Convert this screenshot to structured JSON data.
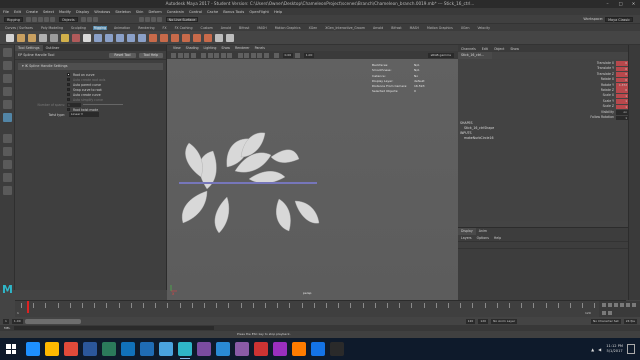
{
  "window": {
    "title": "Autodesk Maya 2017 - Student Version: C:\\Users\\Owner\\Desktop\\ChameleonProject\\scenes\\Branch\\Chameleon_branch.0019.mb* --- Stick_16_ctrl...",
    "workspace": "Workspace:",
    "workspace_value": "Maya Classic"
  },
  "menubar": [
    "File",
    "Edit",
    "Create",
    "Select",
    "Modify",
    "Display",
    "Windows",
    "Skeleton",
    "Skin",
    "Deform",
    "Constrain",
    "Control",
    "Cache",
    "Bonus Tools",
    "OpenFlight",
    "Help"
  ],
  "statusline": {
    "mode": "Rigging",
    "objects": "Objects",
    "live": "No Live Surface"
  },
  "shelf": {
    "tabs": [
      "Curves / Surfaces",
      "Poly Modeling",
      "Sculpting",
      "Rigging",
      "Animation",
      "Rendering",
      "FX",
      "FX Caching",
      "Custom",
      "Arnold",
      "Bifrost",
      "MASH",
      "Motion Graphics",
      "XGen",
      "XGen_Interactive_Groom",
      "Arnold",
      "Bifrost",
      "MASH",
      "Motion Graphics",
      "XGen",
      "Velocity"
    ],
    "active_index": 3
  },
  "tool_settings": {
    "tabs": [
      "Tool Settings",
      "Outliner"
    ],
    "tool_name": "EP Spline Handle Tool",
    "reset_label": "Reset Tool",
    "help_label": "Tool Help",
    "section": "IK Spline Handle Settings",
    "options": [
      {
        "label": "Root on curve",
        "checked": true,
        "enabled": true
      },
      {
        "label": "Auto create root axis",
        "checked": false,
        "enabled": false
      },
      {
        "label": "Auto parent curve",
        "checked": false,
        "enabled": true
      },
      {
        "label": "Snap curve to root",
        "checked": false,
        "enabled": true
      },
      {
        "label": "Auto create curve",
        "checked": false,
        "enabled": true
      },
      {
        "label": "Auto simplify curve",
        "checked": false,
        "enabled": false
      }
    ],
    "spans_label": "Number of spans:",
    "spans_value": "1",
    "root_twist_label": "Root twist mode",
    "twist_type_label": "Twist type:",
    "twist_type_value": "Linear"
  },
  "viewport": {
    "menu": [
      "View",
      "Shading",
      "Lighting",
      "Show",
      "Renderer",
      "Panels"
    ],
    "exposure": "0.00",
    "gamma": "1.00",
    "color_space": "sRGB gamma",
    "camera": "persp",
    "hud": [
      {
        "label": "Backfaces:",
        "value": "N/A"
      },
      {
        "label": "Smoothness:",
        "value": "N/A"
      },
      {
        "label": "Instance:",
        "value": "No"
      },
      {
        "label": "Display Layer:",
        "value": "default"
      },
      {
        "label": "Distance From Camera:",
        "value": "16.593"
      },
      {
        "label": "Selected Objects:",
        "value": "0"
      }
    ]
  },
  "channel_box": {
    "menu": [
      "Channels",
      "Edit",
      "Object",
      "Show"
    ],
    "object": "Stick_16_ctrl...",
    "attributes": [
      {
        "name": "Translate X",
        "value": "0"
      },
      {
        "name": "Translate Y",
        "value": "0"
      },
      {
        "name": "Translate Z",
        "value": "0"
      },
      {
        "name": "Rotate X",
        "value": "0"
      },
      {
        "name": "Rotate Y",
        "value": "1.372"
      },
      {
        "name": "Rotate Z",
        "value": "0"
      },
      {
        "name": "Scale X",
        "value": "1"
      },
      {
        "name": "Scale Y",
        "value": "1"
      },
      {
        "name": "Scale Z",
        "value": "1"
      },
      {
        "name": "Visibility",
        "value": "on"
      },
      {
        "name": "Follow Rotation",
        "value": "1"
      }
    ],
    "shapes_header": "SHAPES",
    "shape_item": "Stick_16_ctrlShape",
    "inputs_header": "INPUTS",
    "input_item": "makeNurbCircle16"
  },
  "layer_editor": {
    "tabs": [
      "Display",
      "Anim"
    ],
    "menu": [
      "Layers",
      "Options",
      "Help"
    ]
  },
  "timeline": {
    "start": "1",
    "end": "120",
    "range_start": "1.00",
    "range_end": "120",
    "current": "1",
    "anim_layer": "No Anim Layer",
    "char_set": "No Character Set",
    "fps": "24 fps",
    "tick_labels": [
      "1",
      "120"
    ]
  },
  "command": {
    "lang": "MEL"
  },
  "help": {
    "text": "Press the ESC key to stop playback."
  },
  "taskbar": {
    "time": "11:12 PM",
    "date": "5/1/2017",
    "colors": [
      "#1e90ff",
      "#ffb900",
      "#e04a3a",
      "#2b579a",
      "#2b7a5b",
      "#1171ba",
      "#1f6cb5",
      "#4aa3df",
      "#2fb6c8",
      "#7a4ca0",
      "#2a8ad4",
      "#8a5ba6",
      "#c33",
      "#9a2fbf",
      "#ff7c00",
      "#1473e6",
      "#2a2a2a"
    ]
  }
}
